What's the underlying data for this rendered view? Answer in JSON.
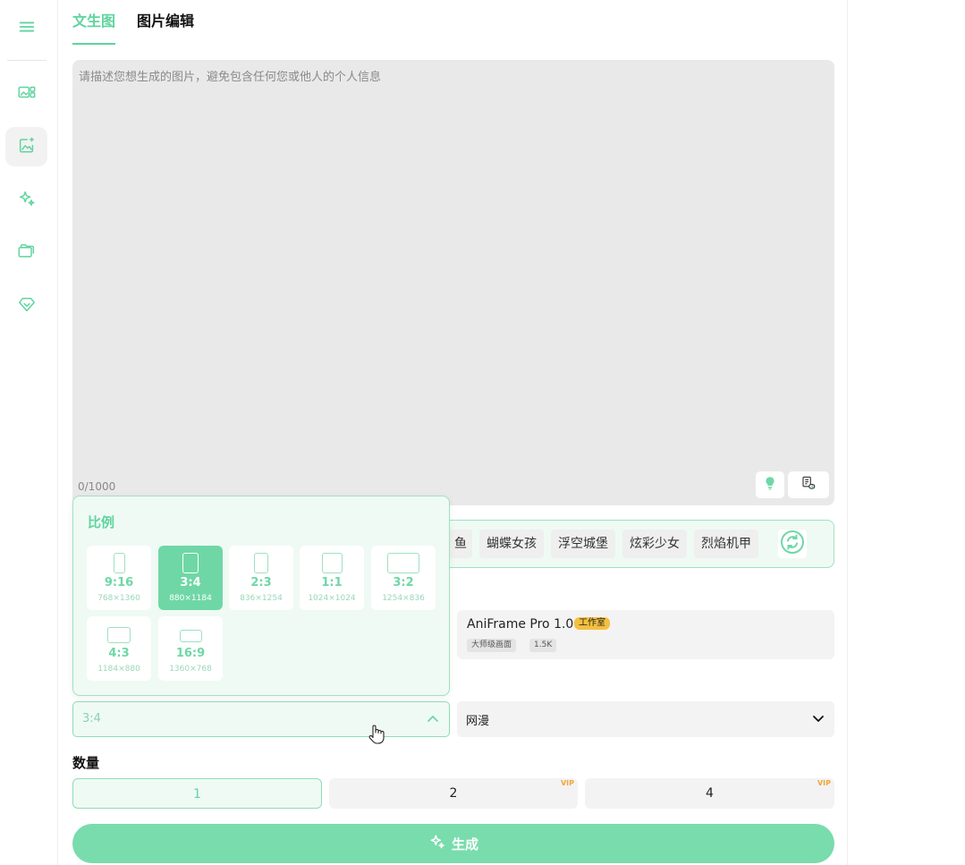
{
  "tabs": [
    {
      "label": "文生图",
      "active": true
    },
    {
      "label": "图片编辑",
      "active": false
    }
  ],
  "sidebar": {
    "menu_icon": "hamburger-icon",
    "items": [
      {
        "icon": "image-gallery-icon",
        "active": false
      },
      {
        "icon": "image-sparkle-icon",
        "active": true
      },
      {
        "icon": "sparkles-icon",
        "active": false
      },
      {
        "icon": "folder-icon",
        "active": false
      },
      {
        "icon": "diamond-icon",
        "active": false
      }
    ]
  },
  "prompt": {
    "placeholder": "请描述您想生成的图片，避免包含任何您或他人的个人信息",
    "value": "",
    "count": "0/1000",
    "buttons": [
      "lightbulb-icon",
      "prompt-tool-icon"
    ]
  },
  "tags": [
    "鱼",
    "蝴蝶女孩",
    "浮空城堡",
    "炫彩少女",
    "烈焰机甲"
  ],
  "model": {
    "name": "AniFrame Pro 1.0",
    "badge": "工作室",
    "meta1": "大师级画面",
    "meta2": "1.5K"
  },
  "ratio_select": {
    "value": "3:4"
  },
  "style_select": {
    "value": "网漫"
  },
  "quantity": {
    "label": "数量",
    "options": [
      {
        "label": "1",
        "selected": true,
        "vip": ""
      },
      {
        "label": "2",
        "selected": false,
        "vip": "VIP"
      },
      {
        "label": "4",
        "selected": false,
        "vip": "VIP"
      }
    ]
  },
  "generate": {
    "label": "生成"
  },
  "ratio_popover": {
    "title": "比例",
    "options": [
      {
        "label": "9:16",
        "size": "768×1360",
        "selected": false
      },
      {
        "label": "3:4",
        "size": "880×1184",
        "selected": true
      },
      {
        "label": "2:3",
        "size": "836×1254",
        "selected": false
      },
      {
        "label": "1:1",
        "size": "1024×1024",
        "selected": false
      },
      {
        "label": "3:2",
        "size": "1254×836",
        "selected": false
      },
      {
        "label": "4:3",
        "size": "1184×880",
        "selected": false
      },
      {
        "label": "16:9",
        "size": "1360×768",
        "selected": false
      }
    ]
  },
  "colors": {
    "accent": "#5fd49e",
    "accent_light": "#effaf4",
    "generate_button": "#79dcad",
    "vip": "#f0a63a",
    "badge": "#f4c040"
  }
}
